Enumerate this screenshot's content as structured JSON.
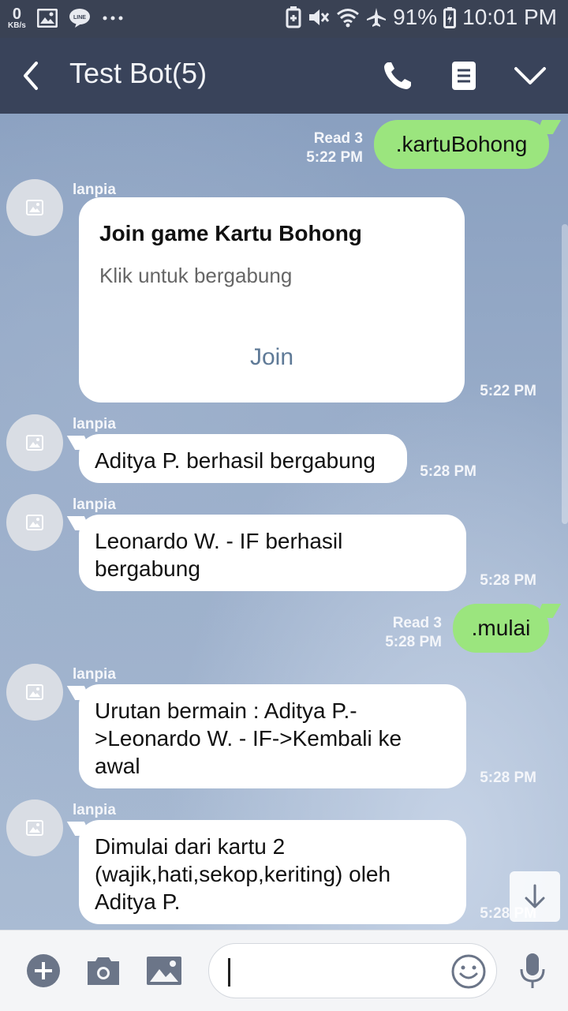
{
  "status_bar": {
    "speed_value": "0",
    "speed_unit": "KB/s",
    "battery": "91%",
    "clock": "10:01 PM",
    "icons": [
      "image-icon",
      "line-icon",
      "more-dots-icon",
      "battery-saver-icon",
      "mute-icon",
      "wifi-icon",
      "airplane-icon",
      "battery-icon"
    ]
  },
  "header": {
    "title": "Test Bot(5)",
    "icons": [
      "back-icon",
      "phone-icon",
      "notes-icon",
      "chevron-down-icon"
    ]
  },
  "messages": [
    {
      "type": "out",
      "text": ".kartuBohong",
      "read": "Read 3",
      "time": "5:22 PM"
    },
    {
      "type": "card",
      "sender": "lanpia",
      "title": "Join game Kartu Bohong",
      "subtitle": "Klik untuk bergabung",
      "action": "Join",
      "time": "5:22 PM"
    },
    {
      "type": "in",
      "sender": "lanpia",
      "text": "Aditya P. berhasil bergabung",
      "time": "5:28 PM"
    },
    {
      "type": "in",
      "sender": "lanpia",
      "text": "Leonardo W. - IF berhasil bergabung",
      "time": "5:28 PM"
    },
    {
      "type": "out",
      "text": ".mulai",
      "read": "Read 3",
      "time": "5:28 PM"
    },
    {
      "type": "in",
      "sender": "lanpia",
      "text": "Urutan bermain : Aditya P.->Leonardo W. - IF->Kembali ke awal",
      "time": "5:28 PM"
    },
    {
      "type": "in",
      "sender": "lanpia",
      "text": "Dimulai dari kartu 2 (wajik,hati,sekop,keriting) oleh Aditya P.",
      "time": "5:28 PM"
    }
  ],
  "input_bar": {
    "icons": [
      "plus-icon",
      "camera-icon",
      "gallery-icon",
      "emoji-icon",
      "microphone-icon"
    ],
    "placeholder": ""
  },
  "colors": {
    "header_bg": "#39435a",
    "outgoing_bubble": "#9be57e",
    "incoming_bubble": "#ffffff",
    "join_link": "#5f7a97"
  }
}
